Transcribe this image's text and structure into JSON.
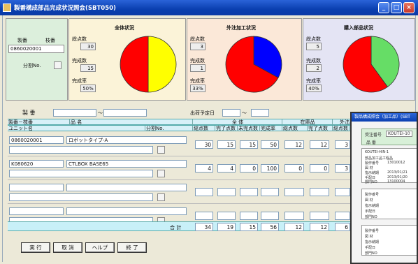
{
  "window": {
    "title": "製番構成部品完成状況照会(SBT050)"
  },
  "left": {
    "seiban_label": "製番",
    "edaban_label": "枝番",
    "seiban_value": "0860020001",
    "bunkatsu_label": "分割No."
  },
  "overall": {
    "title": "全体状況",
    "total_label": "総点数",
    "total_value": "30",
    "done_label": "完成数",
    "done_value": "15",
    "rate_label": "完成率",
    "rate_value": "50%"
  },
  "outsource": {
    "title": "外注加工状況",
    "total_label": "総点数",
    "total_value": "3",
    "done_label": "完成数",
    "done_value": "1",
    "rate_label": "完成率",
    "rate_value": "33%"
  },
  "purchase": {
    "title": "購入部品状況",
    "total_label": "総点数",
    "total_value": "5",
    "done_label": "完成数",
    "done_value": "2",
    "rate_label": "完成率",
    "rate_value": "40%"
  },
  "search": {
    "seiban_label": "製 番",
    "tilde": "～",
    "ship_label": "出荷予定日",
    "tilde2": "～"
  },
  "table": {
    "h1": [
      "製番－枝番",
      "品 名",
      "全 体",
      "在庫品",
      "外注品"
    ],
    "h2": [
      "ユニット名",
      "分割No.",
      "総点数",
      "完了点数",
      "未完点数",
      "完成率",
      "総点数",
      "完了点数",
      "総点数",
      "完了"
    ],
    "rows": [
      {
        "code": "0860020001",
        "name": "ロボットタイプ-A",
        "v": [
          "30",
          "15",
          "15",
          "50",
          "12",
          "12",
          "3"
        ]
      },
      {
        "code": "K080620",
        "name": "CTLBOX BASE65",
        "v": [
          "4",
          "4",
          "0",
          "100",
          "0",
          "0",
          "3"
        ]
      }
    ],
    "total_label": "合 計",
    "totals": [
      "34",
      "19",
      "15",
      "56",
      "12",
      "12",
      "6"
    ]
  },
  "buttons": {
    "run": "実 行",
    "cancel": "取 消",
    "help": "ヘルプ",
    "exit": "終 了"
  },
  "second": {
    "title": "製品構成照会（加工品）(SBT",
    "order_label": "受注番号",
    "order_value": "KOUTEI-10",
    "product_label": "品 番",
    "lines": [
      "KOUTEI-HIN-1",
      "部品加工品工程品",
      "製作番号",
      "図 材",
      "指示納期",
      "手配日",
      "部門NO"
    ],
    "values": [
      "13010012",
      "",
      "2013/01/21",
      "2013/01/20",
      "13100004"
    ]
  },
  "chart_data": [
    {
      "type": "pie",
      "title": "全体状況",
      "values": [
        50,
        50
      ],
      "colors": [
        "#ff0000",
        "#ffff00"
      ]
    },
    {
      "type": "pie",
      "title": "外注加工状況",
      "values": [
        67,
        33
      ],
      "colors": [
        "#ff0000",
        "#0000ff"
      ]
    },
    {
      "type": "pie",
      "title": "購入部品状況",
      "values": [
        60,
        40
      ],
      "colors": [
        "#ff0000",
        "#66dd66"
      ]
    }
  ]
}
